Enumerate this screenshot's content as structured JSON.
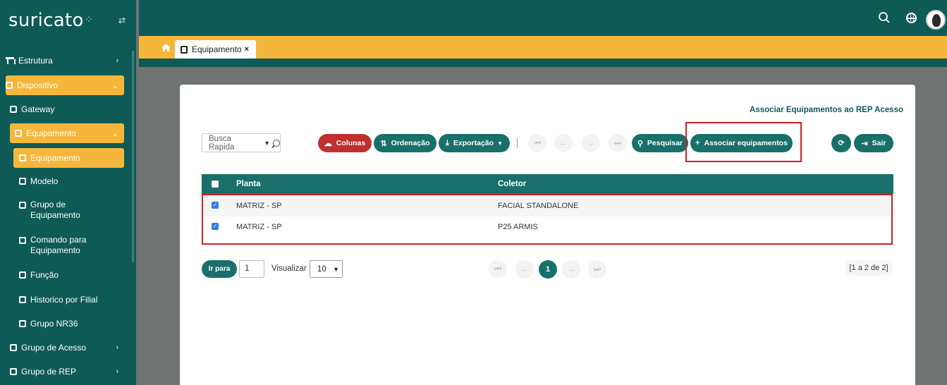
{
  "app": {
    "logo": "suricato"
  },
  "sidebar": {
    "items": [
      {
        "label": "Estrutura"
      },
      {
        "label": "Dispositivo"
      },
      {
        "label": "Gateway"
      },
      {
        "label": "Equipamento"
      },
      {
        "label": "Equipamento"
      },
      {
        "label": "Modelo"
      },
      {
        "label": "Grupo de Equipamento"
      },
      {
        "label": "Comando para Equipamento"
      },
      {
        "label": "Função"
      },
      {
        "label": "Historico por Filial"
      },
      {
        "label": "Grupo NR36"
      },
      {
        "label": "Grupo de Acesso"
      },
      {
        "label": "Grupo de REP"
      }
    ]
  },
  "tabs": [
    {
      "label": "Equipamento",
      "close": "×"
    }
  ],
  "modal": {
    "title": "Associar Equipamentos ao REP Acesso",
    "quick_search": {
      "placeholder": "Busca Rapida"
    },
    "toolbar": {
      "columns": "Colunas",
      "sort": "Ordenação",
      "export": "Exportação",
      "search": "Pesquisar",
      "associate": "Associar equipamentos",
      "exit": "Sair"
    },
    "table": {
      "headers": [
        "Planta",
        "Coletor"
      ],
      "rows": [
        {
          "planta": "MATRIZ - SP",
          "coletor": "FACIAL STANDALONE",
          "checked": true
        },
        {
          "planta": "MATRIZ - SP",
          "coletor": "P25 ARMIS",
          "checked": true
        }
      ]
    },
    "pagination": {
      "goto_label": "Ir para",
      "page_value": "1",
      "view_label": "Visualizar",
      "page_size": "10",
      "current_page": "1",
      "count": "[1 a 2 de 2]"
    }
  },
  "colors": {
    "brand": "#0e5a57",
    "accent": "#f5b73b",
    "danger": "#c0302e",
    "highlight": "#d42020"
  }
}
